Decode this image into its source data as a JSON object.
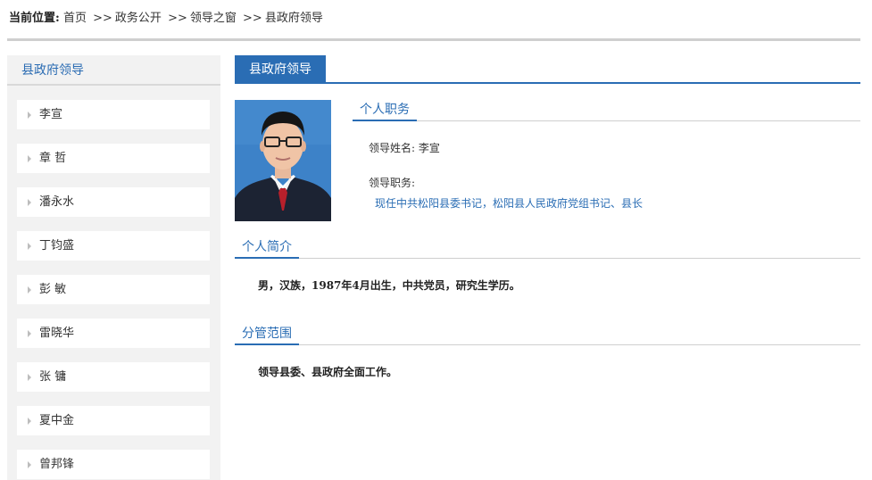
{
  "breadcrumb": {
    "label": "当前位置:",
    "items": [
      "首页",
      "政务公开",
      "领导之窗",
      "县政府领导"
    ],
    "separator": ">>"
  },
  "sidebar": {
    "title": "县政府领导",
    "items": [
      {
        "label": "李宣"
      },
      {
        "label": "章 哲"
      },
      {
        "label": "潘永水"
      },
      {
        "label": "丁钧盛"
      },
      {
        "label": "彭 敏"
      },
      {
        "label": "雷晓华"
      },
      {
        "label": "张 镛"
      },
      {
        "label": "夏中金"
      },
      {
        "label": "曾邦锋"
      }
    ]
  },
  "content": {
    "tab": "县政府领导",
    "duty_section": {
      "title": "个人职务",
      "name_label": "领导姓名:",
      "name": "李宣",
      "position_label": "领导职务:",
      "position": "现任中共松阳县委书记，松阳县人民政府党组书记、县长"
    },
    "bio_section": {
      "title": "个人简介",
      "text": "男，汉族，1987年4月出生，中共党员，研究生学历。"
    },
    "scope_section": {
      "title": "分管范围",
      "text": "领导县委、县政府全面工作。"
    }
  },
  "colors": {
    "accent": "#2a6db4",
    "sidebar_bg": "#f2f2f2",
    "photo_bg": "#3f84c9"
  }
}
